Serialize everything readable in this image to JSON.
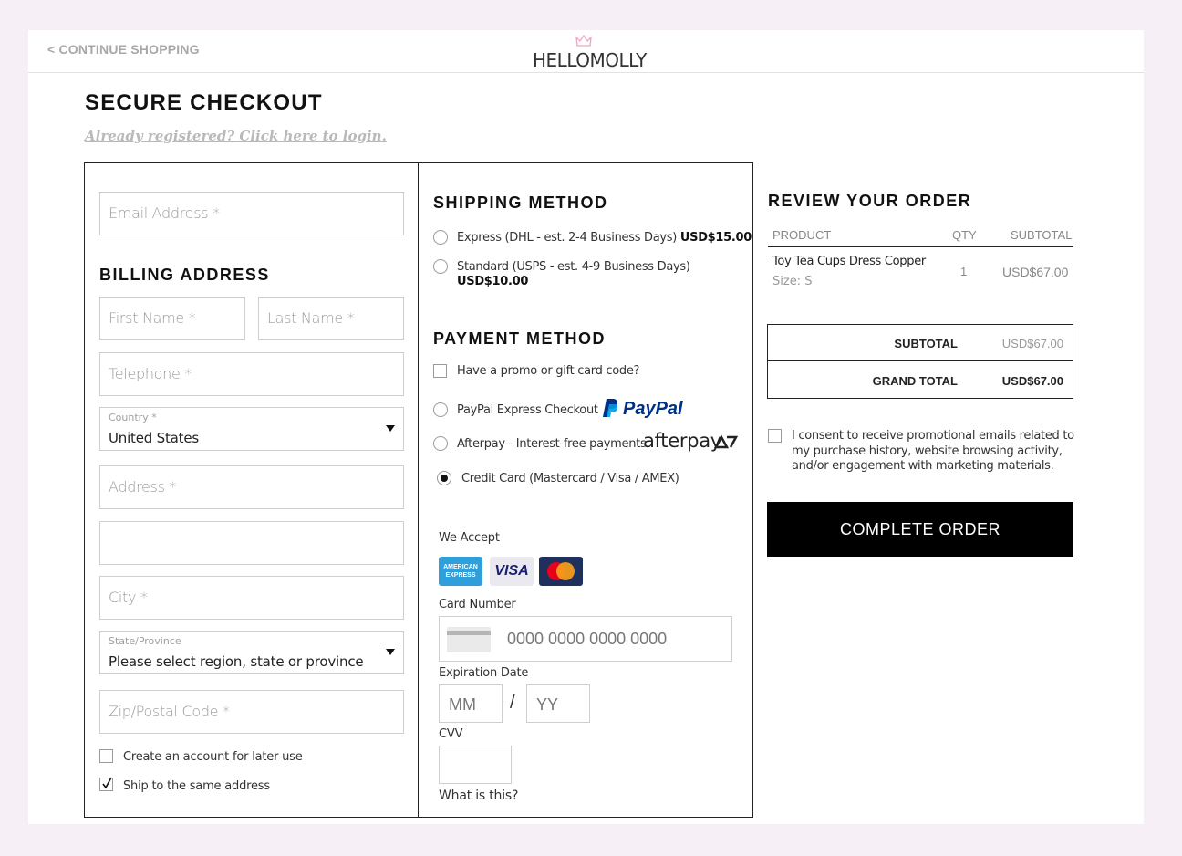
{
  "header": {
    "continue_label": "< CONTINUE SHOPPING",
    "logo_text": "HELLOMOLLY"
  },
  "page": {
    "title": "SECURE CHECKOUT",
    "login_link": "Already registered? Click here to login."
  },
  "billing": {
    "email_placeholder": "Email Address *",
    "heading": "BILLING ADDRESS",
    "first_name_placeholder": "First Name *",
    "last_name_placeholder": "Last Name *",
    "telephone_placeholder": "Telephone *",
    "country_label": "Country *",
    "country_value": "United States",
    "address_placeholder": "Address *",
    "address2_placeholder": "",
    "city_placeholder": "City *",
    "state_label": "State/Province",
    "state_value": "Please select region, state or province",
    "zip_placeholder": "Zip/Postal Code *",
    "create_account_label": "Create an account for later use",
    "create_account_checked": false,
    "ship_same_label": "Ship to the same address",
    "ship_same_checked": true
  },
  "shipping": {
    "heading": "SHIPPING METHOD",
    "options": [
      {
        "label": "Express (DHL - est. 2-4 Business Days)",
        "price": "USD$15.00",
        "selected": false
      },
      {
        "label": "Standard (USPS - est. 4-9 Business Days)",
        "price": "USD$10.00",
        "selected": false
      }
    ]
  },
  "payment": {
    "heading": "PAYMENT METHOD",
    "promo_label": "Have a promo or gift card code?",
    "paypal_label": "PayPal Express Checkout",
    "paypal_logo": "PayPal",
    "afterpay_label": "Afterpay - Interest-free payments",
    "afterpay_logo": "afterpay",
    "credit_label": "Credit Card (Mastercard / Visa / AMEX)",
    "selected": "credit",
    "we_accept": "We Accept",
    "amex_logo": "AMERICAN EXPRESS",
    "visa_logo": "VISA",
    "card_number_label": "Card Number",
    "card_number_placeholder": "0000 0000 0000 0000",
    "expiration_label": "Expiration Date",
    "mm_placeholder": "MM",
    "yy_placeholder": "YY",
    "exp_separator": "/",
    "cvv_label": "CVV",
    "what_is_this": "What is this?"
  },
  "review": {
    "heading": "REVIEW YOUR ORDER",
    "col_product": "PRODUCT",
    "col_qty": "QTY",
    "col_subtotal": "SUBTOTAL",
    "items": [
      {
        "name": "Toy Tea Cups Dress Copper",
        "size": "Size: S",
        "qty": "1",
        "subtotal": "USD$67.00"
      }
    ],
    "subtotal_label": "SUBTOTAL",
    "subtotal_value": "USD$67.00",
    "grand_total_label": "GRAND TOTAL",
    "grand_total_value": "USD$67.00",
    "consent_text": "I consent to receive promotional emails related to my purchase history, website browsing activity, and/or engagement with marketing materials.",
    "complete_button": "COMPLETE ORDER"
  },
  "colors": {
    "background": "#f7eff6",
    "paypal_dark": "#003087",
    "paypal_light": "#009cde",
    "accent_black": "#000000",
    "mastercard_red": "#eb001b",
    "mastercard_orange": "#f79e1b",
    "amex_blue": "#2e9fdb",
    "visa_blue": "#1a1f71"
  }
}
